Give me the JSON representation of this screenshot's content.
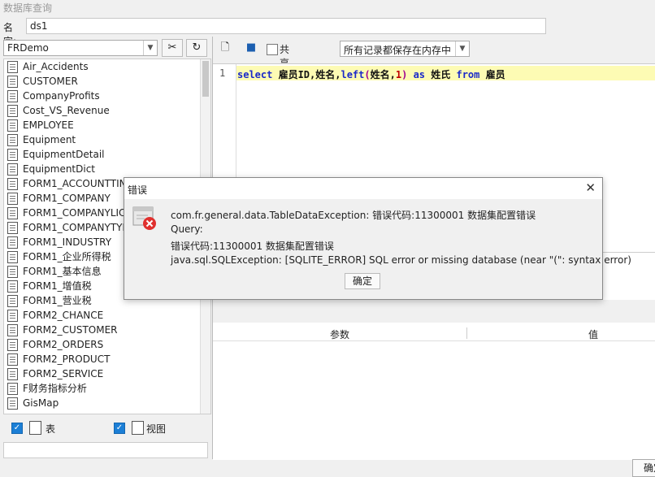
{
  "window": {
    "title": "数据库查询"
  },
  "name_field": {
    "label": "名字:",
    "value": "ds1"
  },
  "datasource": {
    "selected": "FRDemo"
  },
  "tables": [
    "Air_Accidents",
    "CUSTOMER",
    "CompanyProfits",
    "Cost_VS_Revenue",
    "EMPLOYEE",
    "Equipment",
    "EquipmentDetail",
    "EquipmentDict",
    "FORM1_ACCOUNTTIN",
    "FORM1_COMPANY",
    "FORM1_COMPANYLIC",
    "FORM1_COMPANYTYF",
    "FORM1_INDUSTRY",
    "FORM1_企业所得税",
    "FORM1_基本信息",
    "FORM1_增值税",
    "FORM1_营业税",
    "FORM2_CHANCE",
    "FORM2_CUSTOMER",
    "FORM2_ORDERS",
    "FORM2_PRODUCT",
    "FORM2_SERVICE",
    "F财务指标分析",
    "GisMap"
  ],
  "filters": {
    "table_label": "表",
    "view_label": "视图"
  },
  "toolbar": {
    "share_label": "共享数据集",
    "memory_option": "所有记录都保存在内存中"
  },
  "editor": {
    "line_no": "1",
    "sql_tokens": {
      "select": "select",
      "cols": " 雇员ID,姓名,",
      "fn": "left",
      "open": "(",
      "arg": "姓名,",
      "num": "1",
      "close": ")",
      "as": "as",
      "alias": " 姓氏 ",
      "from": "from",
      "table": " 雇员"
    }
  },
  "params": {
    "col_param": "参数",
    "col_value": "值"
  },
  "footer": {
    "ok_label": "确定"
  },
  "dialog": {
    "title": "错误",
    "line1": "com.fr.general.data.TableDataException: 错误代码:11300001 数据集配置错误",
    "line2": "Query:",
    "line3": "错误代码:11300001 数据集配置错误",
    "line4": "java.sql.SQLException: [SQLITE_ERROR] SQL error or missing database (near \"(\": syntax error)",
    "ok_label": "确定"
  }
}
